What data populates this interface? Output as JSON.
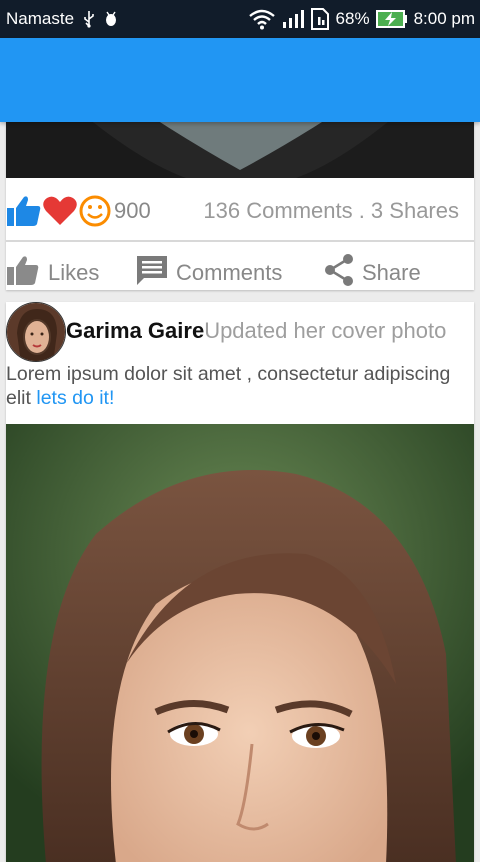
{
  "statusbar": {
    "carrier": "Namaste",
    "battery_percent": "68%",
    "time": "8:00 pm"
  },
  "feed": {
    "reactions": {
      "count": "900",
      "comments_shares": "136 Comments . 3 Shares"
    },
    "actions": {
      "likes": "Likes",
      "comments": "Comments",
      "share": "Share"
    },
    "post": {
      "author": "Garima Gaire",
      "action": "Updated her cover photo",
      "body": "Lorem ipsum dolor sit amet , consectetur adipiscing elit ",
      "link": "lets do it!"
    }
  },
  "colors": {
    "appbar": "#2196f3",
    "link": "#2196f3",
    "like_blue": "#1e88e5",
    "love_red": "#e53935",
    "haha_orange": "#fb8c00"
  }
}
